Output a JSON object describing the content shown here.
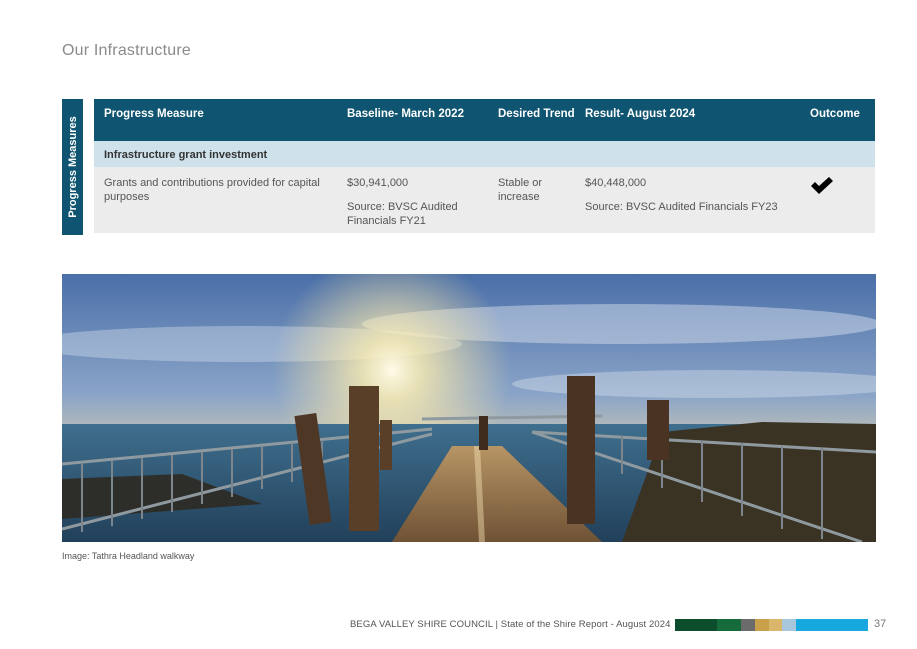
{
  "page": {
    "title": "Our Infrastructure",
    "side_tab_label": "Progress Measures"
  },
  "table": {
    "headers": {
      "progress_measure": "Progress Measure",
      "baseline": "Baseline- March 2022",
      "desired_trend": "Desired Trend",
      "result": "Result- August 2024",
      "outcome": "Outcome"
    },
    "section": "Infrastructure grant investment",
    "row": {
      "measure": "Grants and contributions provided for capital purposes",
      "baseline_value": "$30,941,000",
      "baseline_source": "Source: BVSC Audited Financials FY21",
      "trend": "Stable or increase",
      "result_value": "$40,448,000",
      "result_source": "Source: BVSC Audited Financials FY23",
      "outcome_icon": "checkmark-icon"
    }
  },
  "image": {
    "caption": "Image: Tathra Headland walkway"
  },
  "footer": {
    "text": "BEGA VALLEY SHIRE COUNCIL | State of the Shire Report - August 2024",
    "page_number": "37",
    "colors": [
      "#0b4d2c",
      "#156b3a",
      "#6b6b6b",
      "#c8a04a",
      "#d9b66a",
      "#a9c7dc",
      "#17a8df"
    ]
  },
  "colors": {
    "header_bg": "#0f5470",
    "section_bg": "#cfe1ea",
    "row_bg": "#ececec"
  }
}
